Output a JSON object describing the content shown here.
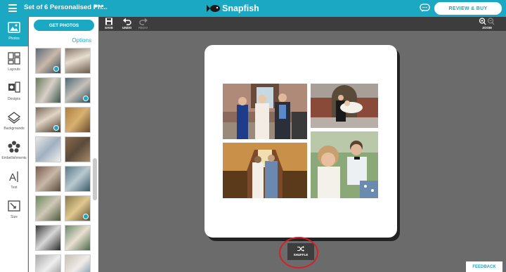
{
  "header": {
    "project_title": "Set of 6 Personalised Ph...",
    "more_label": "•••",
    "brand": "Snapfish",
    "review_buy_label": "REVIEW & BUY"
  },
  "rail": {
    "items": [
      {
        "label": "Photos",
        "icon": "photos-icon"
      },
      {
        "label": "Layouts",
        "icon": "layouts-icon"
      },
      {
        "label": "Designs",
        "icon": "designs-icon"
      },
      {
        "label": "Backgrounds",
        "icon": "backgrounds-icon"
      },
      {
        "label": "Embellishments",
        "icon": "embellishments-icon"
      },
      {
        "label": "Text",
        "icon": "text-icon"
      },
      {
        "label": "Size",
        "icon": "size-icon"
      }
    ]
  },
  "panel": {
    "get_photos_label": "GET PHOTOS",
    "options_label": "Options"
  },
  "toolbar": {
    "save_label": "SAVE",
    "undo_label": "UNDO",
    "redo_label": "REDO",
    "zoom_label": "ZOOM"
  },
  "canvas": {
    "shuffle_label": "SHUFFLE"
  },
  "feedback_label": "FEEDBACK",
  "colors": {
    "brand": "#1ba8c2",
    "toolbar": "#3d3d3d",
    "workspace": "#6b6b6b",
    "highlight": "#d61f26"
  }
}
